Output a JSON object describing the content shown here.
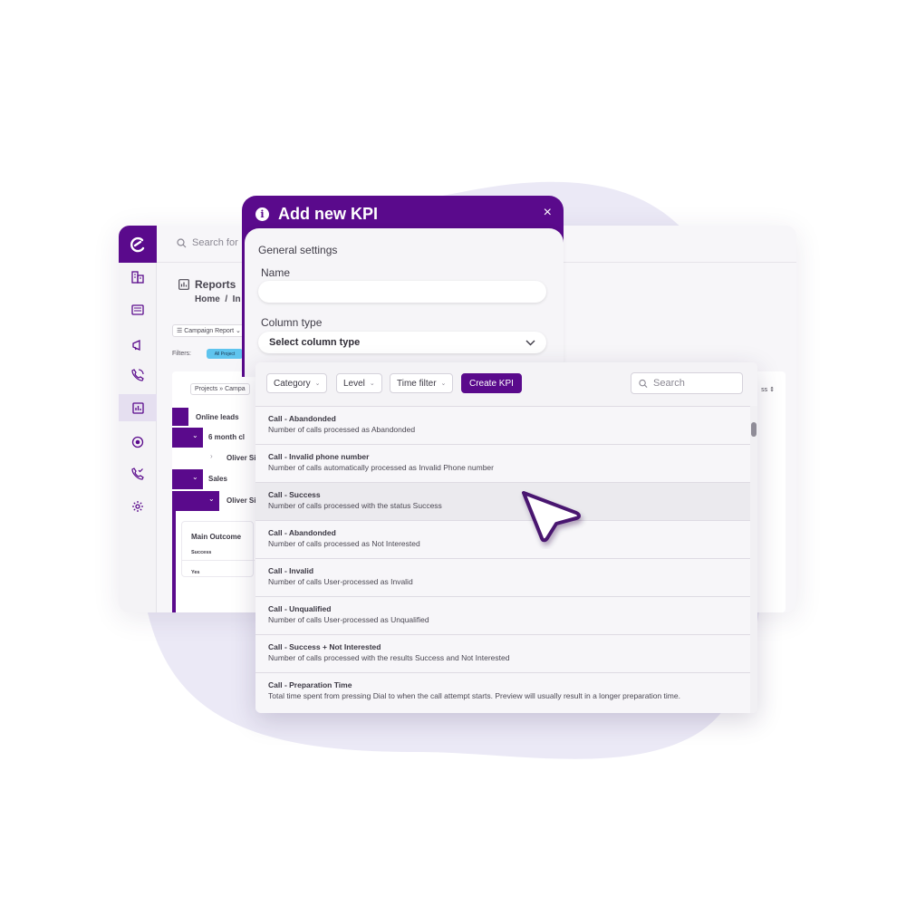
{
  "colors": {
    "brand": "#5a0a8c",
    "blob": "#ebe9f6",
    "filter_pill": "#5fc4ee"
  },
  "app": {
    "logo_icon": "brand-logo-icon",
    "search_placeholder": "Search for",
    "page_title": "Reports",
    "breadcrumb": "Home  /  In",
    "report_selector": "Campaign Report",
    "filters_label": "Filters:",
    "filter_pill": "All Project",
    "projects_chip": "Projects » Campa",
    "column_sort_label": "ss",
    "tree": {
      "online_leads": "Online leads",
      "six_month": "6 month cl",
      "oliver_1": "Oliver Si",
      "sales": "Sales",
      "oliver_2": "Oliver Si"
    },
    "outcome_card": {
      "title": "Main Outcome",
      "row1": "Success",
      "row2": "Yes"
    },
    "sidebar_icons": [
      "buildings-icon",
      "id-card-icon",
      "megaphone-icon",
      "phone-call-icon",
      "report-chart-icon",
      "target-icon",
      "phone-check-icon",
      "gear-icon"
    ]
  },
  "modal": {
    "title": "Add new KPI",
    "close_label": "×",
    "section": "General settings",
    "name_label": "Name",
    "name_value": "",
    "column_type_label": "Column type",
    "column_type_value": "Select column type"
  },
  "kpi_panel": {
    "filters": {
      "category": "Category",
      "level": "Level",
      "time_filter": "Time filter"
    },
    "create_label": "Create KPI",
    "search_placeholder": "Search",
    "items": [
      {
        "title": "Call - Abandonded",
        "desc": "Number of calls processed as Abandonded"
      },
      {
        "title": "Call - Invalid phone number",
        "desc": "Number of calls automatically processed as Invalid Phone number"
      },
      {
        "title": "Call - Success",
        "desc": "Number of calls processed with the status Success"
      },
      {
        "title": "Call - Abandonded",
        "desc": "Number of calls processed as Not Interested"
      },
      {
        "title": "Call - Invalid",
        "desc": "Number of calls User-processed as Invalid"
      },
      {
        "title": "Call - Unqualified",
        "desc": "Number of calls User-processed as Unqualified"
      },
      {
        "title": "Call - Success + Not Interested",
        "desc": "Number of calls processed with the results Success and Not Interested"
      },
      {
        "title": "Call - Preparation Time",
        "desc": "Total time spent from pressing Dial to when the call attempt starts. Preview will usually result in a longer preparation time."
      }
    ]
  }
}
